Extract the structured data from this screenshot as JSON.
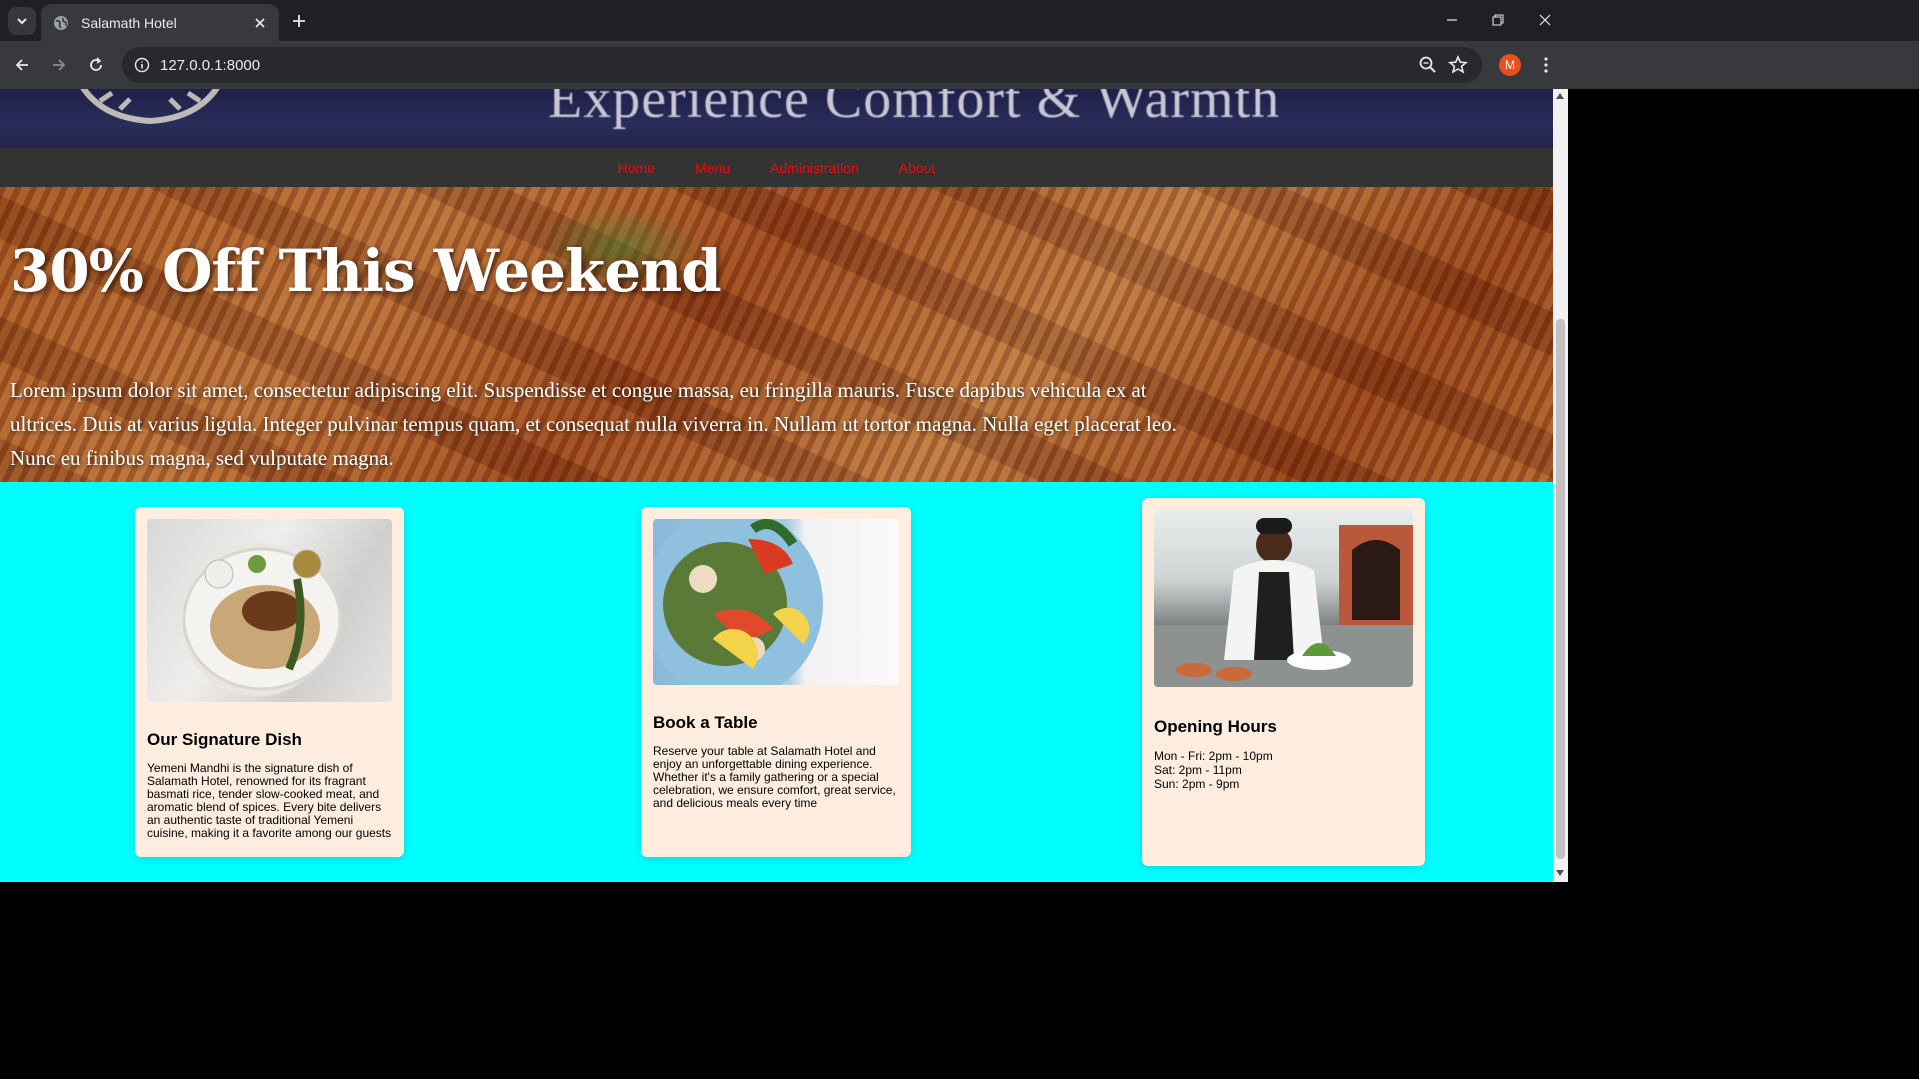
{
  "browser": {
    "tab_title": "Salamath Hotel",
    "url": "127.0.0.1:8000",
    "profile_initial": "M"
  },
  "header": {
    "tagline": "Experience Comfort & Warmth"
  },
  "nav": {
    "items": [
      "Home",
      "Menu",
      "Administration",
      "About"
    ],
    "link_color": "#ff0000"
  },
  "promo": {
    "title": "30% Off This Weekend",
    "body": "Lorem ipsum dolor sit amet, consectetur adipiscing elit. Suspendisse et congue massa, eu fringilla mauris. Fusce dapibus vehicula ex at ultrices. Duis at varius ligula. Integer pulvinar tempus quam, et consequat nulla viverra in. Nullam ut tortor magna. Nulla eget placerat leo. Nunc eu finibus magna, sed vulputate magna."
  },
  "cards": {
    "signature": {
      "title": "Our Signature Dish",
      "text": "Yemeni Mandhi is the signature dish of Salamath Hotel, renowned for its fragrant basmati rice, tender slow-cooked meat, and aromatic blend of spices. Every bite delivers an authentic taste of traditional Yemeni cuisine, making it a favorite among our guests"
    },
    "booking": {
      "title": "Book a Table",
      "text": "Reserve your table at Salamath Hotel and enjoy an unforgettable dining experience. Whether it's a family gathering or a special celebration, we ensure comfort, great service, and delicious meals every time"
    },
    "hours": {
      "title": "Opening Hours",
      "lines": [
        "Mon - Fri: 2pm - 10pm",
        "Sat: 2pm - 11pm",
        "Sun: 2pm - 9pm"
      ]
    }
  },
  "colors": {
    "page_background": "#00ffff",
    "card_background": "#ffeee0",
    "navbar_background": "#333333"
  }
}
